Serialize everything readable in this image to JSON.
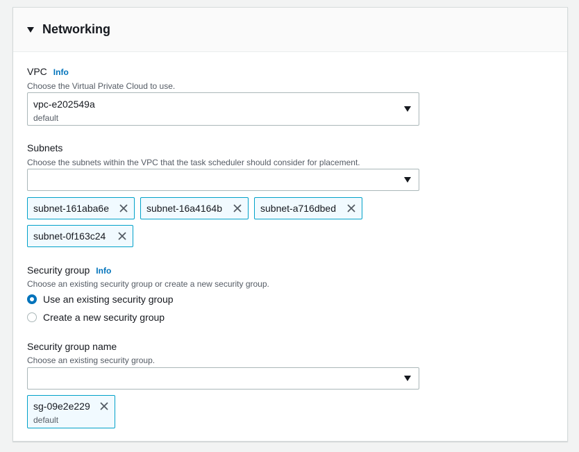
{
  "section": {
    "title": "Networking"
  },
  "vpc": {
    "label": "VPC",
    "info": "Info",
    "description": "Choose the Virtual Private Cloud to use.",
    "selected_value": "vpc-e202549a",
    "selected_sub": "default"
  },
  "subnets": {
    "label": "Subnets",
    "description": "Choose the subnets within the VPC that the task scheduler should consider for placement.",
    "tokens": [
      {
        "label": "subnet-161aba6e"
      },
      {
        "label": "subnet-16a4164b"
      },
      {
        "label": "subnet-a716dbed"
      },
      {
        "label": "subnet-0f163c24"
      }
    ]
  },
  "security_group": {
    "label": "Security group",
    "info": "Info",
    "description": "Choose an existing security group or create a new security group.",
    "options": [
      {
        "label": "Use an existing security group",
        "checked": true
      },
      {
        "label": "Create a new security group",
        "checked": false
      }
    ]
  },
  "security_group_name": {
    "label": "Security group name",
    "description": "Choose an existing security group.",
    "tokens": [
      {
        "label": "sg-09e2e229",
        "sub": "default"
      }
    ]
  },
  "colors": {
    "accent": "#0073bb",
    "token_border": "#00a1c9",
    "token_bg": "#f1faff"
  }
}
